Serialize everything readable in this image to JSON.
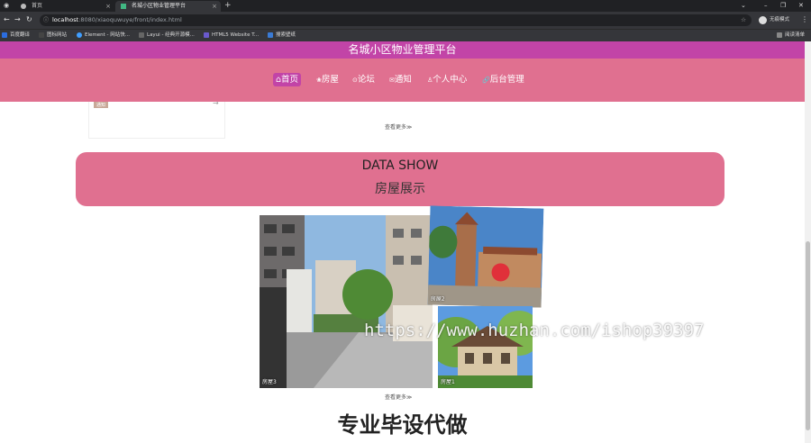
{
  "browser": {
    "tabs": [
      {
        "label": "首页"
      },
      {
        "label": "名城小区物业管理平台"
      }
    ],
    "url": {
      "host": "localhost",
      "path": ":8080/xiaoquwuye/front/index.html"
    },
    "profile_label": "无痕模式",
    "bookmarks": [
      "百度翻译",
      "图标网站",
      "Element - 网站快...",
      "Layui - 经典开源模...",
      "HTML5 Website T...",
      "搜索壁纸"
    ],
    "reading_list": "阅读清单",
    "colors": {
      "tabbar": "#202124",
      "toolbar": "#35363a"
    }
  },
  "site": {
    "title": "名城小区物业管理平台",
    "nav": [
      {
        "icon": "home-icon",
        "glyph": "⌂",
        "label": "首页"
      },
      {
        "icon": "house-icon",
        "glyph": "❀",
        "label": "房屋"
      },
      {
        "icon": "forum-icon",
        "glyph": "⊙",
        "label": "论坛"
      },
      {
        "icon": "notice-icon",
        "glyph": "✉",
        "label": "通知"
      },
      {
        "icon": "user-icon",
        "glyph": "♙",
        "label": "个人中心"
      },
      {
        "icon": "link-icon",
        "glyph": "🔗",
        "label": "后台管理"
      }
    ],
    "colors": {
      "header_top": "#c244a7",
      "header_nav": "#e07090",
      "banner": "#e07090"
    }
  },
  "previous_section": {
    "tag": "通知",
    "more_label": "查看更多≫"
  },
  "data_show": {
    "title_en": "DATA SHOW",
    "title_zh": "房屋展示",
    "photos": [
      {
        "label": "房屋3"
      },
      {
        "label": "房屋2"
      },
      {
        "label": "房屋1"
      }
    ],
    "more_label": "查看更多≫"
  },
  "bottom_title": "专业毕设代做",
  "watermark": "https://www.huzhan.com/ishop39397"
}
